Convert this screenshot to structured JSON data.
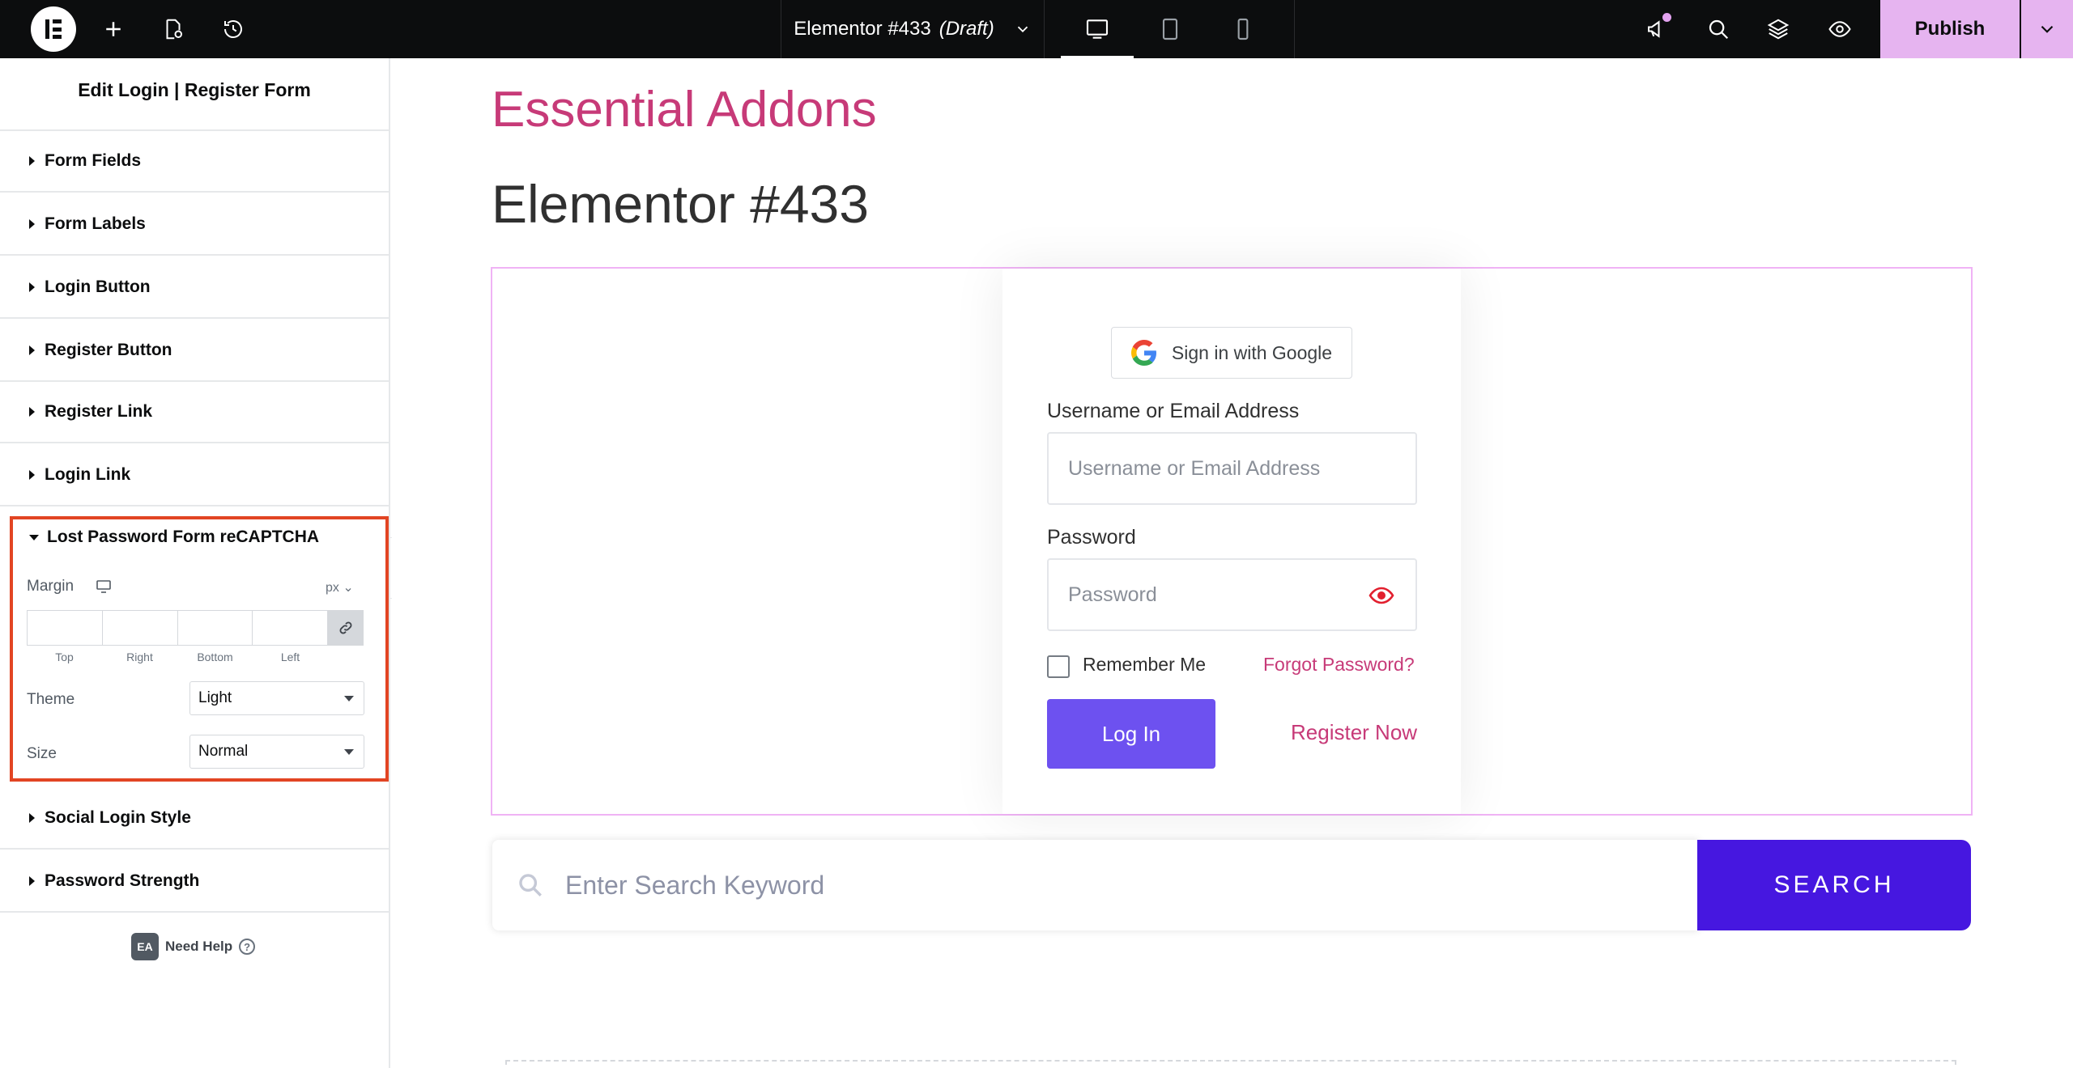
{
  "topbar": {
    "doc_title": "Elementor #433",
    "doc_status": "(Draft)",
    "publish_label": "Publish"
  },
  "panel": {
    "title": "Edit Login | Register Form",
    "sections": [
      {
        "label": "Form Fields"
      },
      {
        "label": "Form Labels"
      },
      {
        "label": "Login Button"
      },
      {
        "label": "Register Button"
      },
      {
        "label": "Register Link"
      },
      {
        "label": "Login Link"
      }
    ],
    "open_section": {
      "label": "Lost Password Form reCAPTCHA",
      "margin_label": "Margin",
      "unit": "px",
      "dim_labels": [
        "Top",
        "Right",
        "Bottom",
        "Left"
      ],
      "theme_label": "Theme",
      "theme_value": "Light",
      "size_label": "Size",
      "size_value": "Normal"
    },
    "sections_after": [
      {
        "label": "Social Login Style"
      },
      {
        "label": "Password Strength"
      }
    ],
    "need_help": "Need Help",
    "ea_badge": "EA"
  },
  "page": {
    "site_title": "Essential Addons",
    "page_title": "Elementor #433"
  },
  "form": {
    "google_label": "Sign in with Google",
    "username_label": "Username or Email Address",
    "username_placeholder": "Username or Email Address",
    "password_label": "Password",
    "password_placeholder": "Password",
    "remember_label": "Remember Me",
    "forgot_label": "Forgot Password?",
    "login_label": "Log In",
    "register_label": "Register Now"
  },
  "search": {
    "placeholder": "Enter Search Keyword",
    "button_label": "SEARCH"
  },
  "colors": {
    "accent_pink": "#c73a78",
    "publish_bg": "#e6b4f0",
    "login_btn": "#6d51f0",
    "search_btn": "#4617e0",
    "highlight_border": "#e24523"
  }
}
